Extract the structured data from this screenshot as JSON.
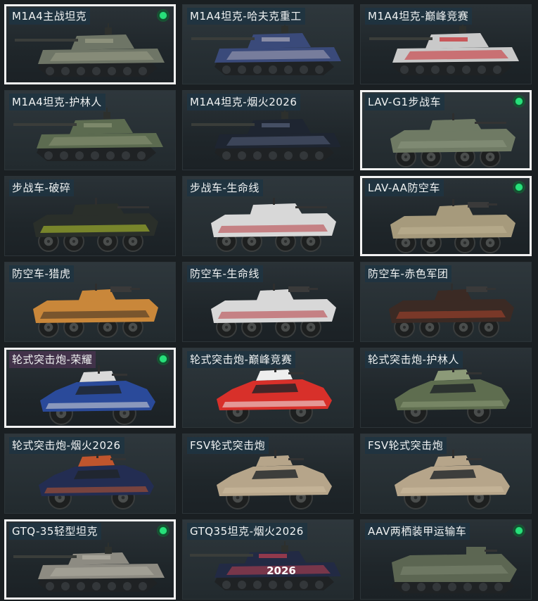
{
  "cards": [
    {
      "label": "M1A4主战坦克",
      "type": "tank",
      "hull": "#6e7566",
      "accent": "#9a9c86",
      "selected": true,
      "owned": true
    },
    {
      "label": "M1A4坦克-哈夫克重工",
      "type": "tank",
      "hull": "#3a4a7a",
      "accent": "#a9a8b8",
      "selected": false,
      "owned": false
    },
    {
      "label": "M1A4坦克-巅峰竞赛",
      "type": "tank",
      "hull": "#c9c9c9",
      "accent": "#c8262b",
      "selected": false,
      "owned": false
    },
    {
      "label": "M1A4坦克-护林人",
      "type": "tank",
      "hull": "#5c6b50",
      "accent": "#8a9475",
      "selected": false,
      "owned": false
    },
    {
      "label": "M1A4坦克-烟火2026",
      "type": "tank",
      "hull": "#1e2531",
      "accent": "#56617a",
      "selected": false,
      "owned": false
    },
    {
      "label": "LAV-G1步战车",
      "type": "ifv",
      "hull": "#6f7a64",
      "accent": "#8f9a82",
      "selected": true,
      "owned": true
    },
    {
      "label": "步战车-破碎",
      "type": "ifv",
      "hull": "#2a2f2a",
      "accent": "#c5dc2c",
      "selected": false,
      "owned": false
    },
    {
      "label": "步战车-生命线",
      "type": "ifv",
      "hull": "#d8d8d8",
      "accent": "#b22a2f",
      "selected": false,
      "owned": false
    },
    {
      "label": "LAV-AA防空车",
      "type": "aa",
      "hull": "#a69a7c",
      "accent": "#c2b695",
      "selected": true,
      "owned": true
    },
    {
      "label": "防空车-猎虎",
      "type": "aa",
      "hull": "#c9873a",
      "accent": "#2a2420",
      "selected": false,
      "owned": false
    },
    {
      "label": "防空车-生命线",
      "type": "aa",
      "hull": "#d8d8d8",
      "accent": "#b22a2f",
      "selected": false,
      "owned": false
    },
    {
      "label": "防空车-赤色军团",
      "type": "aa",
      "hull": "#3b2a24",
      "accent": "#b7452c",
      "selected": false,
      "owned": false
    },
    {
      "label": "轮式突击炮-荣耀",
      "type": "assault",
      "hull": "#2a4a9a",
      "accent": "#d9d9d9",
      "selected": true,
      "owned": true,
      "purple": true
    },
    {
      "label": "轮式突击炮-巅峰竞赛",
      "type": "assault",
      "hull": "#d8302a",
      "accent": "#eeeeee",
      "selected": false,
      "owned": false
    },
    {
      "label": "轮式突击炮-护林人",
      "type": "assault",
      "hull": "#5e6d4f",
      "accent": "#8c9a78",
      "selected": false,
      "owned": false
    },
    {
      "label": "轮式突击炮-烟火2026",
      "type": "assault",
      "hull": "#232d52",
      "accent": "#c0552d",
      "selected": false,
      "owned": false
    },
    {
      "label": "FSV轮式突击炮",
      "type": "fsv",
      "hull": "#b6a58a",
      "accent": "#cdbda1",
      "selected": false,
      "owned": false
    },
    {
      "label": "FSV轮式突击炮",
      "type": "fsv",
      "hull": "#b6a58a",
      "accent": "#cdbda1",
      "selected": false,
      "owned": false
    },
    {
      "label": "GTQ-35轻型坦克",
      "type": "light",
      "hull": "#8d8b82",
      "accent": "#b3b0a4",
      "selected": true,
      "owned": true
    },
    {
      "label": "GTQ35坦克-烟火2026",
      "type": "light",
      "hull": "#222a44",
      "accent": "#c04050",
      "selected": false,
      "owned": false,
      "decal": "2026"
    },
    {
      "label": "AAV两栖装甲运输车",
      "type": "aav",
      "hull": "#5c6652",
      "accent": "#7a8470",
      "selected": false,
      "owned": true
    }
  ]
}
